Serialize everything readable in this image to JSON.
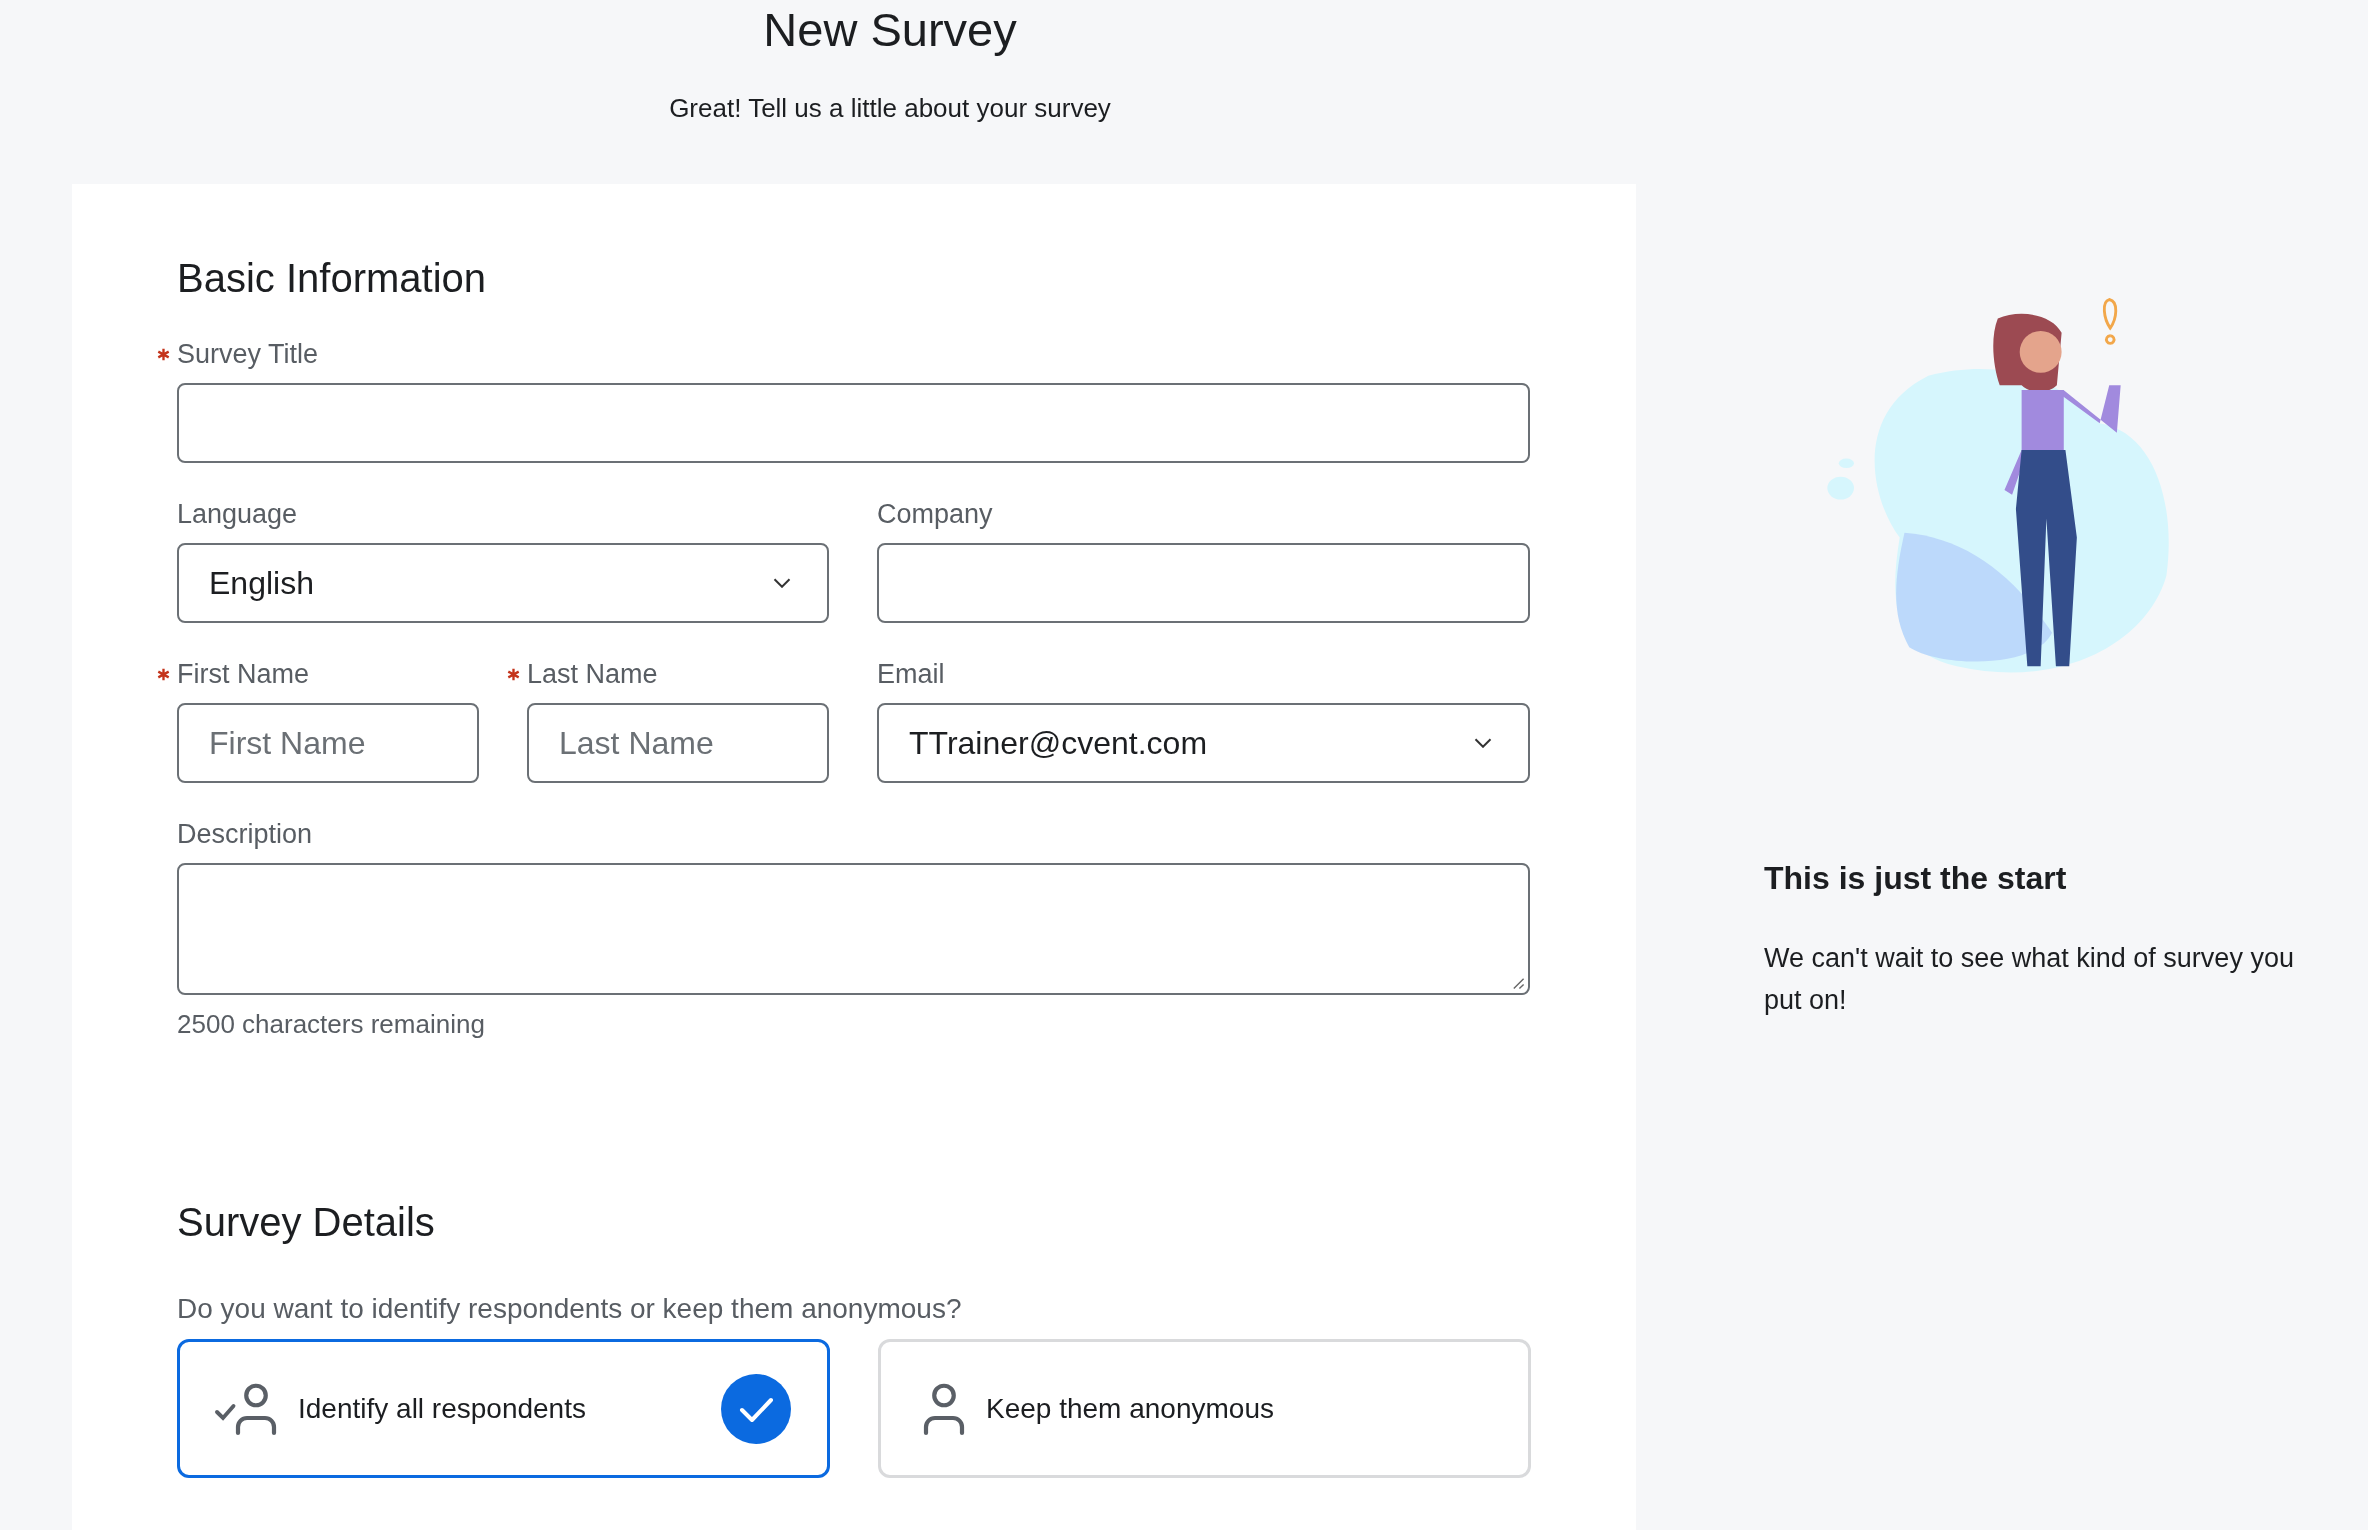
{
  "header": {
    "title": "New Survey",
    "subtitle": "Great! Tell us a little about your survey"
  },
  "basic_information": {
    "heading": "Basic Information",
    "fields": [
      {
        "kind": "text",
        "label": "Survey Title",
        "required": true
      },
      {
        "kind": "select",
        "label": "Language",
        "required": false,
        "value": "English"
      },
      {
        "kind": "text",
        "label": "Company",
        "required": false
      },
      {
        "kind": "text",
        "label": "First Name",
        "required": true,
        "placeholder": "First Name"
      },
      {
        "kind": "text",
        "label": "Last Name",
        "required": true,
        "placeholder": "Last Name"
      },
      {
        "kind": "select",
        "label": "Email",
        "required": false,
        "value": "TTrainer@cvent.com"
      },
      {
        "kind": "textarea",
        "label": "Description",
        "required": false,
        "counter": "2500 characters remaining"
      }
    ]
  },
  "survey_details": {
    "heading": "Survey Details",
    "question": "Do you want to identify respondents or keep them anonymous?",
    "options": [
      {
        "kind": "identify",
        "label": "Identify all respondents",
        "selected": true
      },
      {
        "kind": "anonymous",
        "label": "Keep them anonymous",
        "selected": false
      }
    ]
  },
  "aside": {
    "title": "This is just the start",
    "text": "We can't wait to see what kind of survey you put on!"
  }
}
